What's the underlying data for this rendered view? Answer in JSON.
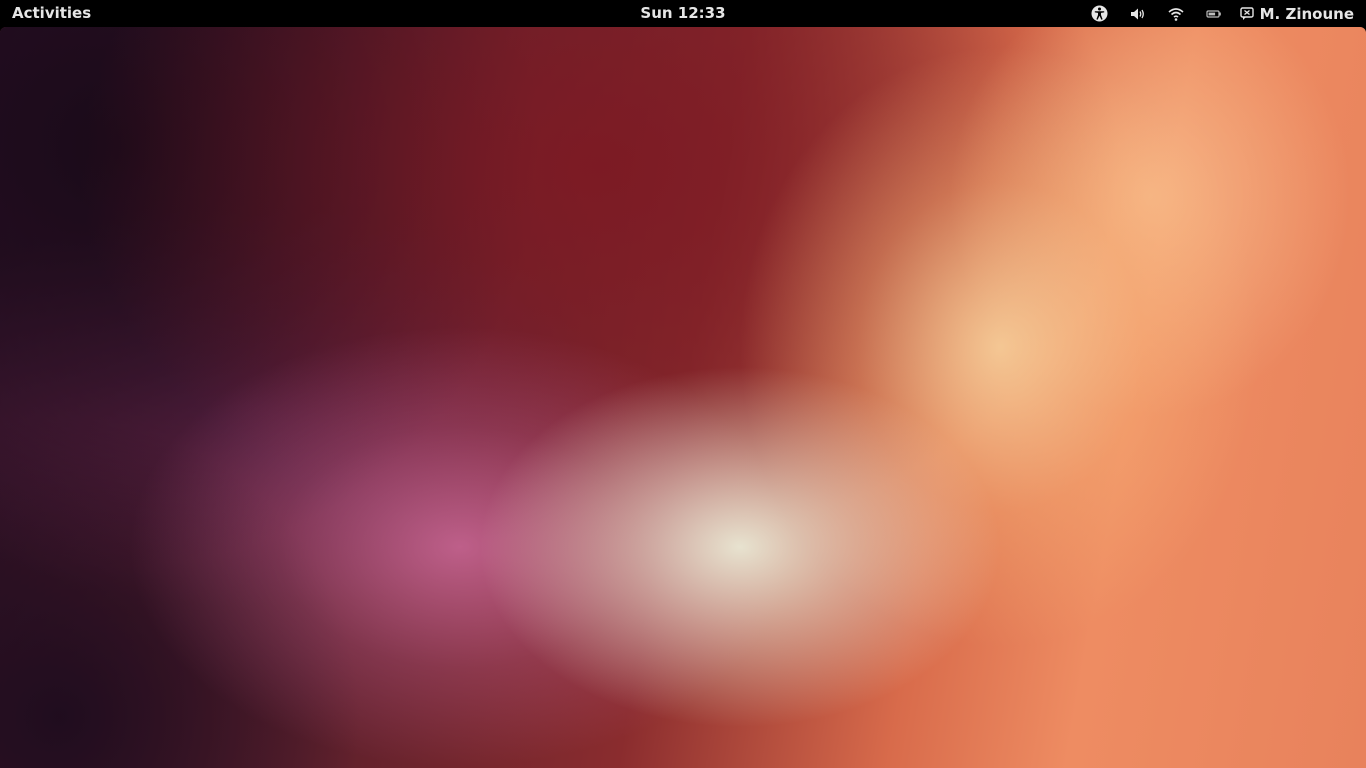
{
  "top_bar": {
    "activities_label": "Activities",
    "clock": "Sun 12:33",
    "tray_icons": [
      "accessibility-icon",
      "volume-icon",
      "wifi-icon",
      "battery-icon"
    ],
    "user_name": "M. Zinoune"
  },
  "colors": {
    "panel_background": "#000000",
    "panel_text": "#e6e6e6"
  }
}
